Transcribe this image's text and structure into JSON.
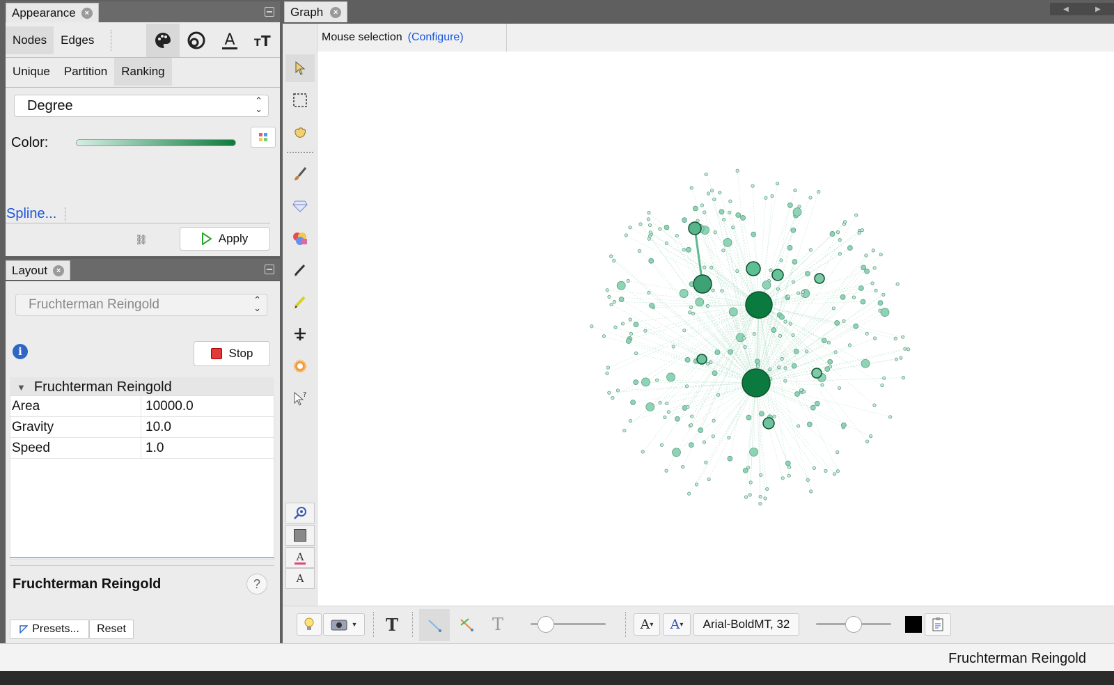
{
  "appearance": {
    "tab_label": "Appearance",
    "nodes_tab": "Nodes",
    "edges_tab": "Edges",
    "icons": [
      "palette-icon",
      "size-icon",
      "label-color-icon",
      "label-size-icon"
    ],
    "modes": [
      "Unique",
      "Partition",
      "Ranking"
    ],
    "attribute": "Degree",
    "color_label": "Color:",
    "spline_link": "Spline...",
    "apply_label": "Apply",
    "gradient_start": "#d6efe4",
    "gradient_end": "#0d7a3c"
  },
  "layout": {
    "tab_label": "Layout",
    "algorithm": "Fruchterman Reingold",
    "stop_label": "Stop",
    "section_title": "Fruchterman Reingold",
    "properties": [
      {
        "name": "Area",
        "value": "10000.0"
      },
      {
        "name": "Gravity",
        "value": "10.0"
      },
      {
        "name": "Speed",
        "value": "1.0"
      }
    ],
    "description_title": "Fruchterman Reingold",
    "presets_label": "Presets...",
    "reset_label": "Reset"
  },
  "graph": {
    "tab_label": "Graph",
    "mouse_selection": "Mouse selection",
    "configure_link": "(Configure)",
    "font_label": "Arial-BoldMT, 32",
    "node_color_light": "#8fd3b7",
    "node_color_dark": "#0b7a3e",
    "edge_color": "#b9e0cf"
  },
  "status": {
    "text": "Fruchterman Reingold"
  }
}
